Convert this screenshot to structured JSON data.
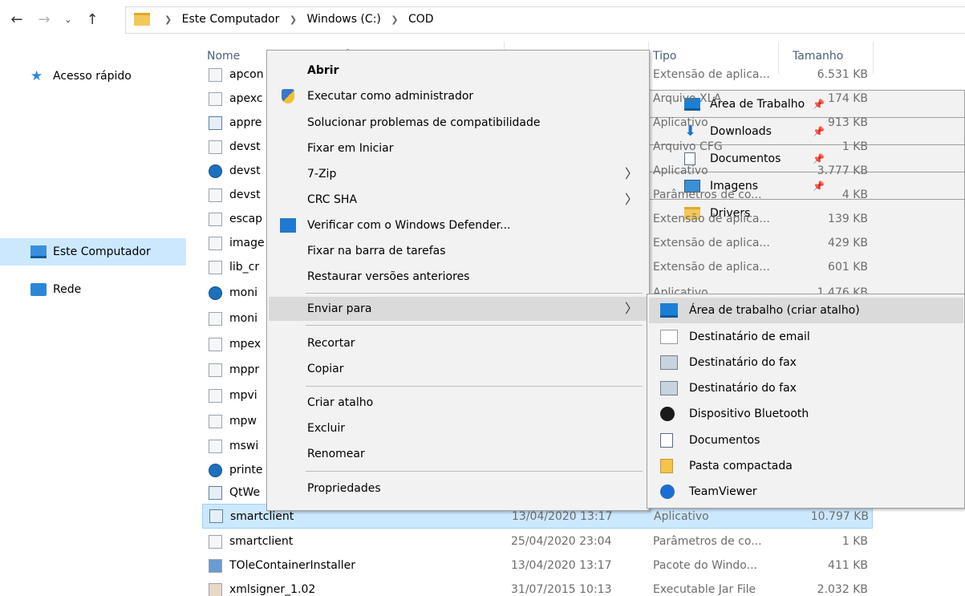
{
  "address": {
    "crumbs": [
      "Este Computador",
      "Windows (C:)",
      "COD"
    ]
  },
  "sidebar": {
    "items": [
      {
        "label": "Acesso rápido",
        "pinned": false
      },
      {
        "label": "Área de Trabalho",
        "pinned": true
      },
      {
        "label": "Downloads",
        "pinned": true
      },
      {
        "label": "Documentos",
        "pinned": true
      },
      {
        "label": "Imagens",
        "pinned": true
      },
      {
        "label": "Drivers",
        "pinned": false
      },
      {
        "label": "Este Computador",
        "pinned": false
      },
      {
        "label": "Rede",
        "pinned": false
      }
    ],
    "pin_glyph": "📌"
  },
  "columns": {
    "name": "Nome",
    "type": "Tipo",
    "size": "Tamanho"
  },
  "files": [
    {
      "name": "apcon",
      "date": "",
      "type": "Extensão de aplica...",
      "size": "6.531 KB"
    },
    {
      "name": "apexc",
      "date": "",
      "type": "Arquivo XLA",
      "size": "174 KB"
    },
    {
      "name": "appre",
      "date": "",
      "type": "Aplicativo",
      "size": "913 KB"
    },
    {
      "name": "devst",
      "date": "",
      "type": "Arquivo CFG",
      "size": "1 KB"
    },
    {
      "name": "devst",
      "date": "",
      "type": "Aplicativo",
      "size": "3.777 KB"
    },
    {
      "name": "devst",
      "date": "",
      "type": "Parâmetros de co...",
      "size": "4 KB"
    },
    {
      "name": "escap",
      "date": "",
      "type": "Extensão de aplica...",
      "size": "139 KB"
    },
    {
      "name": "image",
      "date": "",
      "type": "Extensão de aplica...",
      "size": "429 KB"
    },
    {
      "name": "lib_cr",
      "date": "",
      "type": "Extensão de aplica...",
      "size": "601 KB"
    },
    {
      "name": "moni",
      "date": "",
      "type": "Aplicativo",
      "size": "1.476 KB"
    },
    {
      "name": "moni",
      "date": "",
      "type": "",
      "size": ""
    },
    {
      "name": "mpex",
      "date": "",
      "type": "",
      "size": ""
    },
    {
      "name": "mppr",
      "date": "",
      "type": "",
      "size": ""
    },
    {
      "name": "mpvi",
      "date": "",
      "type": "",
      "size": ""
    },
    {
      "name": "mpw",
      "date": "",
      "type": "",
      "size": ""
    },
    {
      "name": "mswi",
      "date": "",
      "type": "",
      "size": ""
    },
    {
      "name": "printe",
      "date": "",
      "type": "",
      "size": ""
    },
    {
      "name": "QtWe",
      "date": "",
      "type": "",
      "size": ""
    },
    {
      "name": "smartclient",
      "date": "13/04/2020 13:17",
      "type": "Aplicativo",
      "size": "10.797 KB"
    },
    {
      "name": "smartclient",
      "date": "25/04/2020 23:04",
      "type": "Parâmetros de co...",
      "size": "1 KB"
    },
    {
      "name": "TOleContainerInstaller",
      "date": "13/04/2020 13:17",
      "type": "Pacote do Windo...",
      "size": "411 KB"
    },
    {
      "name": "xmlsigner_1.02",
      "date": "31/07/2015 10:13",
      "type": "Executable Jar File",
      "size": "2.032 KB"
    }
  ],
  "context_menu": {
    "items": [
      {
        "label": "Abrir",
        "bold": true
      },
      {
        "label": "Executar como administrador",
        "icon": "uac-shield-icon"
      },
      {
        "label": "Solucionar problemas de compatibilidade"
      },
      {
        "label": "Fixar em Iniciar"
      },
      {
        "label": "7-Zip",
        "submenu": true
      },
      {
        "label": "CRC SHA",
        "submenu": true
      },
      {
        "label": "Verificar com o Windows Defender...",
        "icon": "defender-icon"
      },
      {
        "label": "Fixar na barra de tarefas"
      },
      {
        "label": "Restaurar versões anteriores"
      },
      {
        "label": "Enviar para",
        "submenu": true,
        "hover": true
      },
      {
        "label": "Recortar"
      },
      {
        "label": "Copiar"
      },
      {
        "label": "Criar atalho"
      },
      {
        "label": "Excluir"
      },
      {
        "label": "Renomear"
      },
      {
        "label": "Propriedades"
      }
    ],
    "arrow_glyph": "〉"
  },
  "send_to_menu": {
    "items": [
      {
        "label": "Área de trabalho (criar atalho)",
        "icon": "desktop-icon"
      },
      {
        "label": "Destinatário de email",
        "icon": "mail-icon"
      },
      {
        "label": "Destinatário do fax",
        "icon": "fax-icon"
      },
      {
        "label": "Destinatário do fax",
        "icon": "fax-icon"
      },
      {
        "label": "Dispositivo Bluetooth",
        "icon": "bluetooth-icon"
      },
      {
        "label": "Documentos",
        "icon": "documents-icon"
      },
      {
        "label": "Pasta compactada",
        "icon": "zip-folder-icon"
      },
      {
        "label": "TeamViewer",
        "icon": "teamviewer-icon"
      }
    ]
  },
  "colors": {
    "selection": "#cce8ff",
    "menu_bg": "#f2f2f2",
    "menu_hover": "#dadada"
  }
}
